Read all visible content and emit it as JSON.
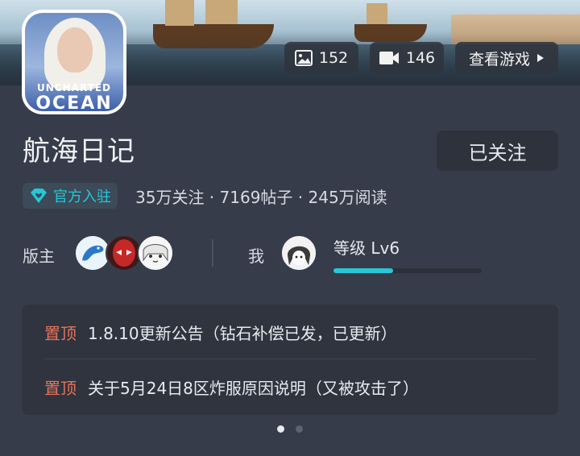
{
  "banner": {
    "images_count": "152",
    "videos_count": "146",
    "view_game_label": "查看游戏"
  },
  "app_icon": {
    "brand_line1": "UNCHARTED",
    "brand_line2": "OCEAN"
  },
  "header": {
    "title": "航海日记",
    "follow_label": "已关注"
  },
  "badge": {
    "label": "官方入驻",
    "icon": "diamond-heart-icon",
    "color": "#27c7d6"
  },
  "stats": "35万关注 · 7169帖子 · 245万阅读",
  "moderators": {
    "label": "版主",
    "avatars": [
      "dolphin-avatar",
      "spiderman-avatar",
      "anime-girl-avatar"
    ]
  },
  "me": {
    "label": "我",
    "level_label": "等级 Lv6",
    "level_progress": 0.4
  },
  "pinned": [
    {
      "tag": "置顶",
      "text": "1.8.10更新公告（钻石补偿已发，已更新）"
    },
    {
      "tag": "置顶",
      "text": "关于5月24日8区炸服原因说明（又被攻击了）"
    }
  ],
  "pager": {
    "pages": 2,
    "active": 0
  },
  "colors": {
    "accent": "#27c7d6",
    "pin_tag": "#e8735a",
    "background": "#363c4a"
  }
}
